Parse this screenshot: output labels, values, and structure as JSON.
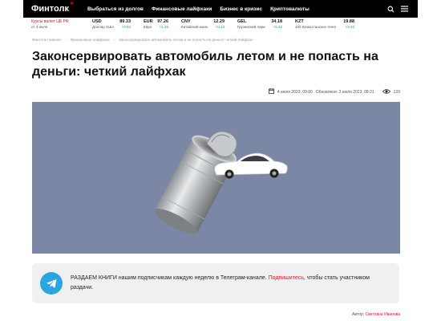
{
  "header": {
    "logo_text": "Финтолк",
    "logo_mark": "”",
    "nav": [
      {
        "label": "Выбраться из долгов"
      },
      {
        "label": "Финансовые лайфхаки"
      },
      {
        "label": "Бизнес в кризис"
      },
      {
        "label": "Криптовалюты"
      }
    ],
    "icons": [
      "search-icon",
      "menu-icon"
    ]
  },
  "rates": {
    "title": "Курсы валют ЦБ РФ",
    "date": "от 4 июля",
    "items": [
      {
        "code": "USD",
        "value": "89.33",
        "name": "Доллар США",
        "delta": "+0.94"
      },
      {
        "code": "EUR",
        "value": "97.26",
        "name": "Евро",
        "delta": "+1.26"
      },
      {
        "code": "CNY",
        "value": "12.29",
        "name": "Китайский юань",
        "delta": "+0.13"
      },
      {
        "code": "GEL",
        "value": "34.18",
        "name": "Грузинский лари",
        "delta": "+0.42"
      },
      {
        "code": "KZT",
        "value": "19.88",
        "name": "100 Казахстанских тенге",
        "delta": "+0.42"
      }
    ]
  },
  "breadcrumb": {
    "items": [
      "Финтолк главная",
      "Финансовые лайфхаки",
      "Законсервировать автомобиль летом и не попасть на деньги: четкий лайфхак"
    ],
    "separator": "›"
  },
  "article": {
    "title": "Законсервировать автомобиль летом и не попасть на деньги: четкий лайфхак",
    "published": "4 июля 2023, 09:00",
    "updated": "Обновлено: 3 июля 2023, 08:21",
    "views": "139",
    "hero_colors": {
      "background": "#7b87a4",
      "car": "#ffffff",
      "can": "#c9cbcc"
    }
  },
  "promo": {
    "strong": "РАЗДАЕМ КНИГИ",
    "text_before": " нашим подписчикам каждую неделю в Телеграм-канале. ",
    "link": "Подпишитесь",
    "text_after": ", чтобы стать участником раздачи."
  },
  "author": {
    "label": "Автор:",
    "name": "Светлана Иванова"
  },
  "colors": {
    "accent": "#e3161f",
    "positive": "#2aa84a",
    "telegram": "#2ca5e0",
    "topbar": "#000000"
  }
}
